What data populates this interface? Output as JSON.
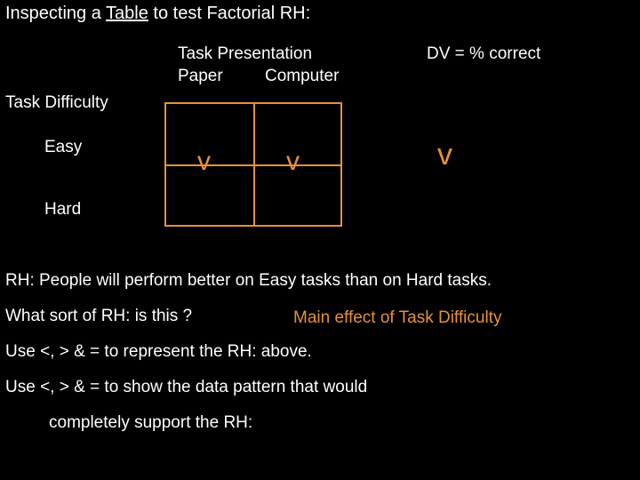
{
  "title_1": "Inspecting a ",
  "title_2": "Table",
  "title_3": " to test Factorial RH:",
  "tp": "Task Presentation",
  "paper": "Paper",
  "computer": "Computer",
  "dv": "DV = % correct",
  "td": "Task Difficulty",
  "easy": "Easy",
  "hard": "Hard",
  "v1": "v",
  "v2": "v",
  "v3": "v",
  "rh": "RH: People will perform better on Easy tasks than on Hard tasks.",
  "what": "What sort of RH: is this ?",
  "answer": "Main effect of Task Difficulty",
  "use1": "Use <, > & = to represent the RH: above.",
  "use2": "Use <, > & = to show the data pattern that would",
  "support": "completely support the RH:"
}
